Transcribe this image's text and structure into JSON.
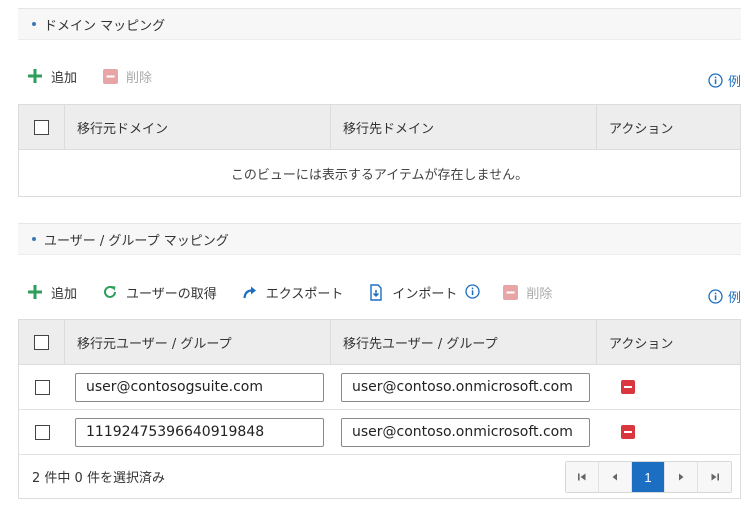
{
  "domain_section": {
    "title": "ドメイン マッピング",
    "toolbar": {
      "add": "追加",
      "delete": "削除",
      "example": "例"
    },
    "columns": [
      "移行元ドメイン",
      "移行先ドメイン",
      "アクション"
    ],
    "empty_message": "このビューには表示するアイテムが存在しません。"
  },
  "user_section": {
    "title": "ユーザー / グループ マッピング",
    "toolbar": {
      "add": "追加",
      "get_users": "ユーザーの取得",
      "export": "エクスポート",
      "import": "インポート",
      "delete": "削除",
      "example": "例"
    },
    "columns": [
      "移行元ユーザー / グループ",
      "移行先ユーザー / グループ",
      "アクション"
    ],
    "rows": [
      {
        "source": "user@contosogsuite.com",
        "target": "user@contoso.onmicrosoft.com"
      },
      {
        "source": "11192475396640919848",
        "target": "user@contoso.onmicrosoft.com"
      }
    ],
    "selection_status": "2 件中 0 件を選択済み",
    "current_page": "1"
  },
  "colors": {
    "accent": "#1b6ec2",
    "add_green": "#2e9e5a",
    "delete_red": "#d9363e",
    "disabled": "#e8a5a5"
  }
}
